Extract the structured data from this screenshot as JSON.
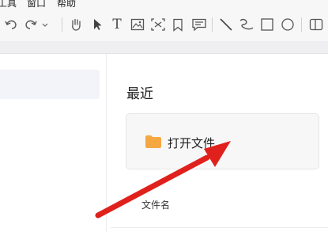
{
  "menubar": {
    "items": [
      "工具",
      "窗口",
      "帮助"
    ]
  },
  "toolbar": {
    "tools": [
      {
        "name": "undo-icon"
      },
      {
        "name": "redo-icon"
      },
      {
        "name": "more-dropdown-icon"
      },
      {
        "name": "hand-tool-icon"
      },
      {
        "name": "select-arrow-icon"
      },
      {
        "name": "text-tool-icon",
        "glyph": "T"
      },
      {
        "name": "image-tool-icon"
      },
      {
        "name": "crop-tool-icon"
      },
      {
        "name": "bookmark-icon"
      },
      {
        "name": "comment-icon"
      },
      {
        "name": "line-tool-icon"
      },
      {
        "name": "curve-tool-icon"
      },
      {
        "name": "rectangle-tool-icon"
      },
      {
        "name": "ellipse-tool-icon"
      },
      {
        "name": "panel-toggle-icon"
      }
    ]
  },
  "main": {
    "section_title": "最近",
    "open_file_label": "打开文件",
    "column_header": "文件名"
  },
  "colors": {
    "annotation_arrow": "#e0201c",
    "folder": "#f5a742"
  }
}
